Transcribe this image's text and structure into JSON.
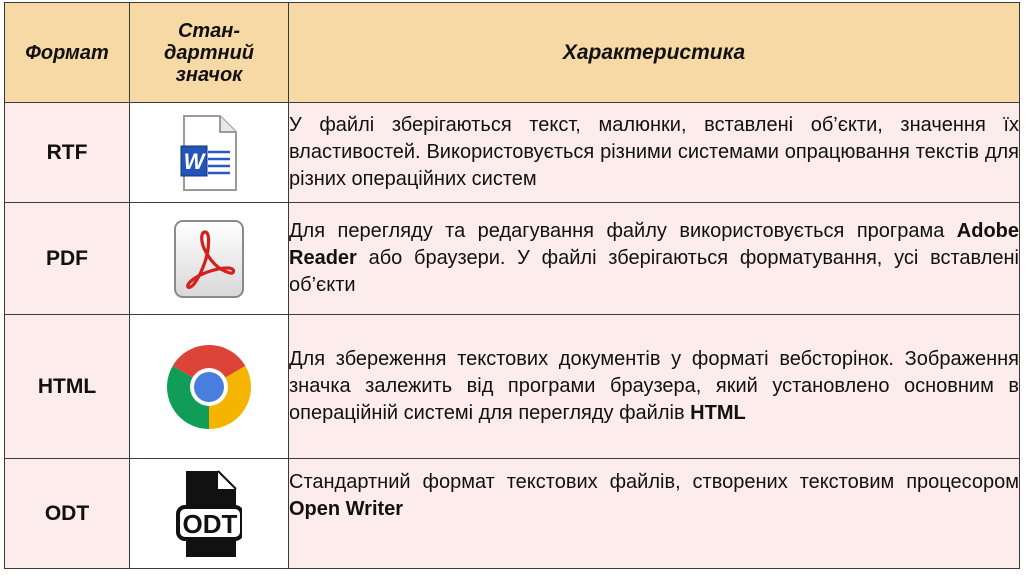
{
  "table": {
    "header": {
      "format": "Формат",
      "icon": [
        "Стан-",
        "дартний",
        "значок"
      ],
      "characteristic": "Характеристика"
    },
    "rows": [
      {
        "format": "RTF",
        "icon": "word-document-icon",
        "desc": [
          {
            "t": "У файлі зберігаються текст, малюнки, вставлені об’єкти, значення їх властивостей. Використовується різними системами опрацювання текстів для різних операційних систем",
            "b": false
          }
        ]
      },
      {
        "format": "PDF",
        "icon": "adobe-reader-icon",
        "desc": [
          {
            "t": "Для перегляду та редагування файлу використовується програма ",
            "b": false
          },
          {
            "t": "Adobe Reader",
            "b": true
          },
          {
            "t": " або браузери. У файлі зберігаються форматування, усі вставлені об’єкти",
            "b": false
          }
        ]
      },
      {
        "format": "HTML",
        "icon": "chrome-browser-icon",
        "desc": [
          {
            "t": "Для збереження текстових документів у форматі вебсторінок. Зображення значка залежить від програми браузера, який установлено основним в операційній системі для перегляду файлів ",
            "b": false
          },
          {
            "t": "HTML",
            "b": true
          }
        ]
      },
      {
        "format": "ODT",
        "icon": "odt-file-icon",
        "desc": [
          {
            "t": "Стандартний формат текстових файлів, створених текстовим процесором ",
            "b": false
          },
          {
            "t": "Open Writer",
            "b": true
          }
        ]
      }
    ]
  },
  "colors": {
    "header_bg": "#f7d9a6",
    "cell_bg": "#fdecec",
    "border": "#3a3a3a"
  }
}
